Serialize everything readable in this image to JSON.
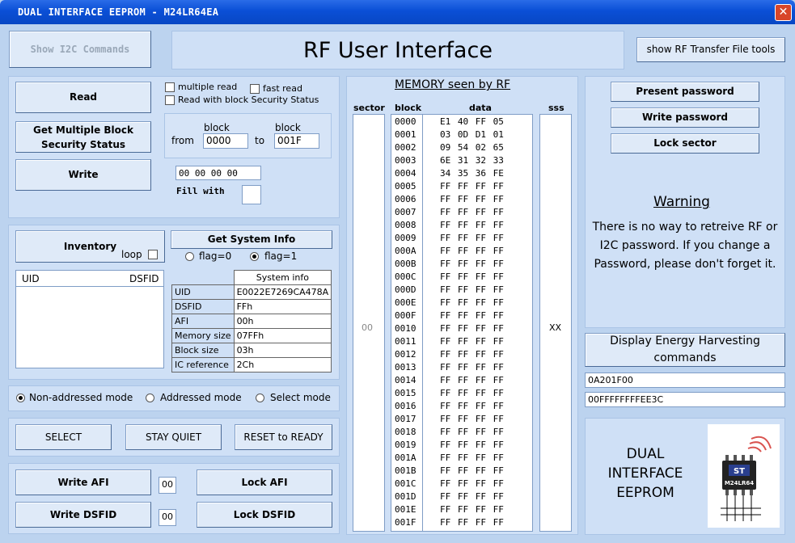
{
  "window": {
    "title": "DUAL INTERFACE EEPROM - M24LR64EA",
    "close_glyph": "✕"
  },
  "header": {
    "show_i2c_label": "Show I2C Commands",
    "main_title": "RF User Interface",
    "show_rf_tools_label": "show RF Transfer File tools"
  },
  "read_panel": {
    "read_label": "Read",
    "get_multiple_label_line1": "Get Multiple Block",
    "get_multiple_label_line2": "Security Status",
    "write_label": "Write",
    "multiple_read_label": "multiple read",
    "fast_read_label": "fast read",
    "read_with_block_label": "Read with block Security Status",
    "block_label": "block",
    "from_label": "from",
    "to_label": "to",
    "from_value": "0000",
    "to_value": "001F",
    "write_data_value": "00 00 00 00",
    "fill_with_label": "Fill with",
    "fill_value": ""
  },
  "inventory_panel": {
    "inventory_label": "Inventory",
    "loop_label": "loop",
    "uid_header": "UID",
    "dsfid_header": "DSFID",
    "get_system_info_label": "Get System Info",
    "flag0_label": "flag=0",
    "flag1_label": "flag=1",
    "sysinfo_header": "System info",
    "rows": [
      {
        "key": "UID",
        "value": "E0022E7269CA478A"
      },
      {
        "key": "DSFID",
        "value": "FFh"
      },
      {
        "key": "AFI",
        "value": "00h"
      },
      {
        "key": "Memory size",
        "value": "07FFh"
      },
      {
        "key": "Block size",
        "value": "03h"
      },
      {
        "key": "IC reference",
        "value": "2Ch"
      }
    ]
  },
  "mode_panel": {
    "non_addressed_label": "Non-addressed mode",
    "addressed_label": "Addressed mode",
    "select_label": "Select mode"
  },
  "state_panel": {
    "select_label": "SELECT",
    "stay_quiet_label": "STAY QUIET",
    "reset_label": "RESET to READY"
  },
  "afi_panel": {
    "write_afi_label": "Write AFI",
    "afi_value": "00",
    "lock_afi_label": "Lock AFI",
    "write_dsfid_label": "Write DSFID",
    "dsfid_value": "00",
    "lock_dsfid_label": "Lock DSFID"
  },
  "memory": {
    "title": "MEMORY seen by RF",
    "sector_header": "sector",
    "block_header": "block",
    "data_header": "data",
    "sss_header": "sss",
    "sector_value": "00",
    "sss_value": "XX",
    "blocks": [
      "0000",
      "0001",
      "0002",
      "0003",
      "0004",
      "0005",
      "0006",
      "0007",
      "0008",
      "0009",
      "000A",
      "000B",
      "000C",
      "000D",
      "000E",
      "000F",
      "0010",
      "0011",
      "0012",
      "0013",
      "0014",
      "0015",
      "0016",
      "0017",
      "0018",
      "0019",
      "001A",
      "001B",
      "001C",
      "001D",
      "001E",
      "001F"
    ],
    "data": [
      "E1 40 FF 05",
      "03 0D D1 01",
      "09 54 02 65",
      "6E 31 32 33",
      "34 35 36 FE",
      "FF FF FF FF",
      "FF FF FF FF",
      "FF FF FF FF",
      "FF FF FF FF",
      "FF FF FF FF",
      "FF FF FF FF",
      "FF FF FF FF",
      "FF FF FF FF",
      "FF FF FF FF",
      "FF FF FF FF",
      "FF FF FF FF",
      "FF FF FF FF",
      "FF FF FF FF",
      "FF FF FF FF",
      "FF FF FF FF",
      "FF FF FF FF",
      "FF FF FF FF",
      "FF FF FF FF",
      "FF FF FF FF",
      "FF FF FF FF",
      "FF FF FF FF",
      "FF FF FF FF",
      "FF FF FF FF",
      "FF FF FF FF",
      "FF FF FF FF",
      "FF FF FF FF",
      "FF FF FF FF"
    ]
  },
  "password_panel": {
    "present_label": "Present password",
    "write_label": "Write password",
    "lock_label": "Lock sector",
    "warning_title": "Warning",
    "warning_text": "There is no way to retreive RF or I2C password. If you change a  Password, please don't forget it."
  },
  "energy_panel": {
    "button_label_line1": "Display Energy Harvesting",
    "button_label_line2": "commands",
    "field1_value": "0A201F00",
    "field2_value": "00FFFFFFFFEE3C"
  },
  "logo_panel": {
    "line1": "DUAL",
    "line2": "INTERFACE",
    "line3": "EEPROM",
    "chip_label": "M24LR64"
  },
  "colors": {
    "background": "#bcd3ef",
    "panel": "#cfe0f6",
    "titlebar": "#0a4fd6"
  }
}
